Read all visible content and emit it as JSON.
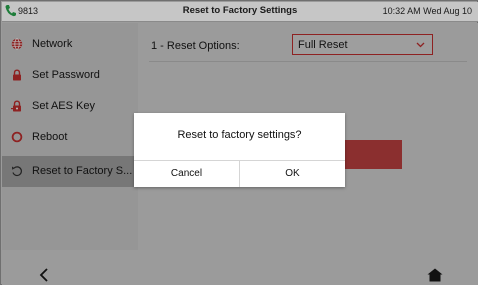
{
  "status_bar": {
    "extension": "9813",
    "title": "Reset to Factory Settings",
    "datetime": "10:32 AM Wed Aug 10"
  },
  "sidebar": {
    "items": [
      {
        "label": "Network",
        "icon": "globe-icon"
      },
      {
        "label": "Set Password",
        "icon": "lock-icon"
      },
      {
        "label": "Set AES Key",
        "icon": "key-lock-icon"
      },
      {
        "label": "Reboot",
        "icon": "circle-icon"
      },
      {
        "label": "Reset to Factory S...",
        "icon": "reset-icon",
        "selected": true
      }
    ]
  },
  "main": {
    "reset_options_label": "1 - Reset Options:",
    "reset_options_value": "Full Reset"
  },
  "dialog": {
    "message": "Reset to factory settings?",
    "cancel_label": "Cancel",
    "ok_label": "OK"
  },
  "colors": {
    "accent_red": "#c8102e",
    "overlay_gray": "#9b9b9b"
  }
}
